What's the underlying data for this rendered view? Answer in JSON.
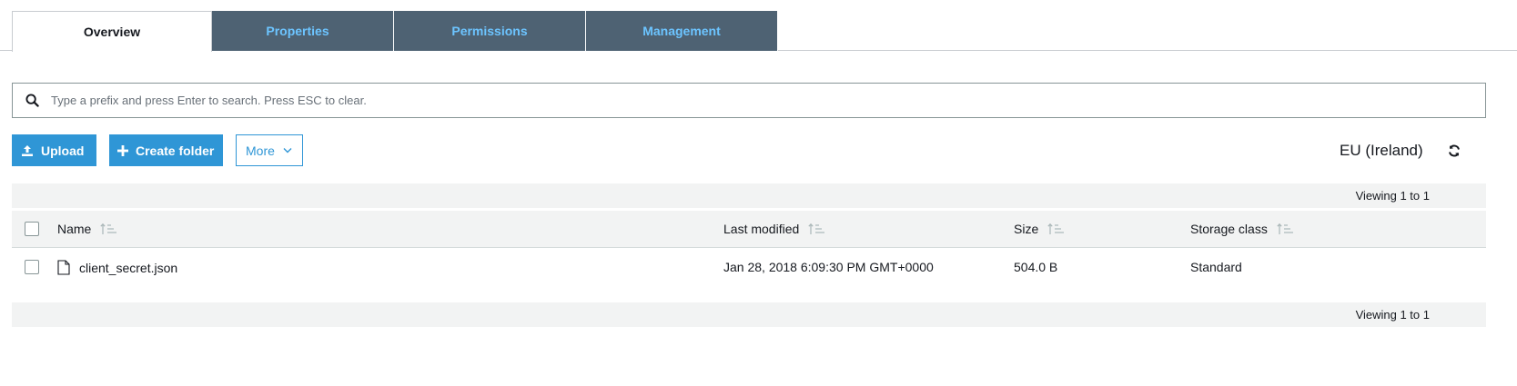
{
  "tabs": [
    {
      "label": "Overview",
      "active": true
    },
    {
      "label": "Properties",
      "active": false
    },
    {
      "label": "Permissions",
      "active": false
    },
    {
      "label": "Management",
      "active": false
    }
  ],
  "search": {
    "placeholder": "Type a prefix and press Enter to search. Press ESC to clear.",
    "icon": "search-icon"
  },
  "toolbar": {
    "upload_label": "Upload",
    "create_folder_label": "Create folder",
    "more_label": "More",
    "region": "EU (Ireland)"
  },
  "table": {
    "pager_top": "Viewing 1 to 1",
    "pager_bottom": "Viewing 1 to 1",
    "columns": [
      "Name",
      "Last modified",
      "Size",
      "Storage class"
    ],
    "rows": [
      {
        "name": "client_secret.json",
        "last_modified": "Jan 28, 2018 6:09:30 PM GMT+0000",
        "size": "504.0 B",
        "storage_class": "Standard"
      }
    ]
  },
  "colors": {
    "primary": "#2f96d6",
    "tab_inactive_bg": "#4e6273",
    "tab_inactive_text": "#6cc4ff"
  }
}
